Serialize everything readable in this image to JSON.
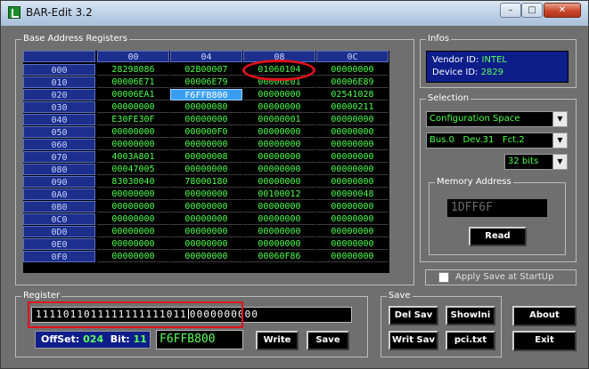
{
  "window": {
    "title": "BAR-Edit 3.2"
  },
  "titlebar_buttons": {
    "minimize": "–",
    "maximize": "□",
    "close": "✕"
  },
  "bar_group": {
    "label": "Base Address Registers"
  },
  "grid": {
    "columns": [
      "00",
      "04",
      "08",
      "0C"
    ],
    "selected": {
      "row": 2,
      "col": 1
    },
    "rows": [
      {
        "offset": "000",
        "cells": [
          "28298086",
          "02B00007",
          "01060104",
          "00000000"
        ]
      },
      {
        "offset": "010",
        "cells": [
          "00006E71",
          "00006E79",
          "00006E01",
          "00006E89"
        ]
      },
      {
        "offset": "020",
        "cells": [
          "00006EA1",
          "F6FFB800",
          "00000000",
          "02541028"
        ]
      },
      {
        "offset": "030",
        "cells": [
          "00000000",
          "00000080",
          "00000000",
          "00000211"
        ]
      },
      {
        "offset": "040",
        "cells": [
          "E30FE30F",
          "00000000",
          "00000001",
          "00000000"
        ]
      },
      {
        "offset": "050",
        "cells": [
          "00000000",
          "000000F0",
          "00000000",
          "00000000"
        ]
      },
      {
        "offset": "060",
        "cells": [
          "00000000",
          "00000000",
          "00000000",
          "00000000"
        ]
      },
      {
        "offset": "070",
        "cells": [
          "4003A801",
          "00000008",
          "00000000",
          "00000000"
        ]
      },
      {
        "offset": "080",
        "cells": [
          "00047005",
          "00000000",
          "00000000",
          "00000000"
        ]
      },
      {
        "offset": "090",
        "cells": [
          "83030040",
          "78000180",
          "00000000",
          "00000000"
        ]
      },
      {
        "offset": "0A0",
        "cells": [
          "00000000",
          "00000000",
          "00100012",
          "00000048"
        ]
      },
      {
        "offset": "0B0",
        "cells": [
          "00000000",
          "00000000",
          "00000000",
          "00000000"
        ]
      },
      {
        "offset": "0C0",
        "cells": [
          "00000000",
          "00000000",
          "00000000",
          "00000000"
        ]
      },
      {
        "offset": "0D0",
        "cells": [
          "00000000",
          "00000000",
          "00000000",
          "00000000"
        ]
      },
      {
        "offset": "0E0",
        "cells": [
          "00000000",
          "00000000",
          "00000000",
          "00000000"
        ]
      },
      {
        "offset": "0F0",
        "cells": [
          "00000000",
          "00000000",
          "00060F86",
          "00000000"
        ]
      }
    ]
  },
  "infos": {
    "label": "Infos",
    "vendor_label": "Vendor ID:",
    "vendor_value": "INTEL",
    "device_label": "Device ID:",
    "device_value": "2829"
  },
  "selection": {
    "label": "Selection",
    "space": "Configuration Space",
    "device": "Bus.0   Dev.31   Fct.2",
    "width": "32 bits",
    "memory_label": "Memory Address",
    "memory_value": "1DFF6F",
    "read_label": "Read"
  },
  "apply_save": {
    "label": "Apply Save at StartUp",
    "checked": false
  },
  "register": {
    "label": "Register",
    "bits_left": "1111011011111111111011",
    "bits_right": "0000000000",
    "offset_label": "OffSet:",
    "offset_value": "024",
    "bit_label": "Bit:",
    "bit_value": "11",
    "value": "F6FFB800",
    "write_label": "Write",
    "save_label": "Save"
  },
  "save_group": {
    "label": "Save",
    "del_sav": "Del Sav",
    "show_ini": "ShowIni",
    "writ_sav": "Writ Sav",
    "pci_txt": "pci.txt"
  },
  "about_label": "About",
  "exit_label": "Exit",
  "colors": {
    "accent_red": "#e0101c",
    "grid_text": "#4dff4d",
    "header_blue": "#1c2f8c",
    "selected_cell": "#3a9ef0"
  }
}
